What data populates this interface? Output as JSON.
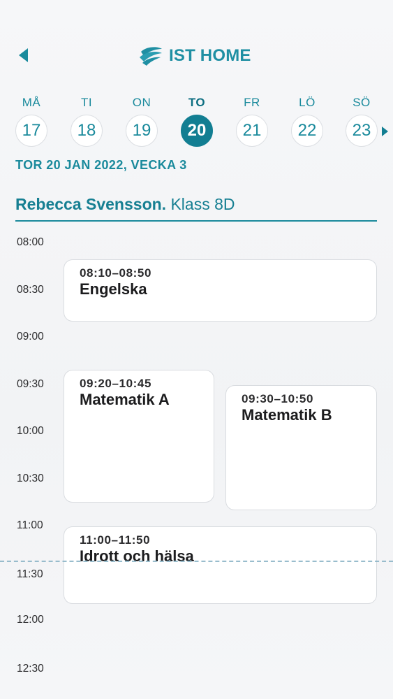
{
  "header": {
    "logo_text": "IST HOME",
    "back_icon": "back-triangle-icon"
  },
  "week": {
    "days": [
      {
        "label": "MÅ",
        "number": "17",
        "active": false
      },
      {
        "label": "TI",
        "number": "18",
        "active": false
      },
      {
        "label": "ON",
        "number": "19",
        "active": false
      },
      {
        "label": "TO",
        "number": "20",
        "active": true
      },
      {
        "label": "FR",
        "number": "21",
        "active": false
      },
      {
        "label": "LÖ",
        "number": "22",
        "active": false
      },
      {
        "label": "SÖ",
        "number": "23",
        "active": false
      }
    ],
    "next_icon": "next-week-triangle-icon"
  },
  "date_line": "TOR 20 JAN 2022, VECKA 3",
  "student": {
    "name": "Rebecca Svensson.",
    "class": "Klass 8D"
  },
  "timeline": {
    "hours": [
      "08:00",
      "08:30",
      "09:00",
      "09:30",
      "10:00",
      "10:30",
      "11:00",
      "11:30",
      "12:00",
      "12:30"
    ]
  },
  "events": [
    {
      "time": "08:10–08:50",
      "title": "Engelska"
    },
    {
      "time": "09:20–10:45",
      "title": "Matematik A"
    },
    {
      "time": "09:30–10:50",
      "title": "Matematik B"
    },
    {
      "time": "11:00–11:50",
      "title": "Idrott och hälsa"
    }
  ],
  "colors": {
    "accent": "#1a8a9c",
    "active_day": "#127e92",
    "now_line": "#8fb6c8"
  }
}
